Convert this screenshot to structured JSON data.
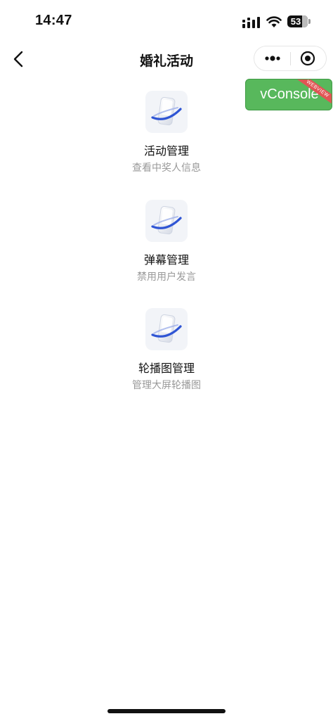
{
  "status_bar": {
    "time": "14:47",
    "battery_level": "53",
    "signal_icon": "signal-bars-icon",
    "wifi_icon": "wifi-icon"
  },
  "nav": {
    "title": "婚礼活动",
    "back_icon": "chevron-left-icon",
    "more_icon": "more-dots-icon",
    "close_icon": "miniprogram-close-icon"
  },
  "vconsole": {
    "label": "vConsole",
    "ribbon": "WEBVIEW",
    "color": "#58b85c"
  },
  "menu": [
    {
      "title": "活动管理",
      "subtitle": "查看中奖人信息",
      "icon": "phone-ring-icon"
    },
    {
      "title": "弹幕管理",
      "subtitle": "禁用用户发言",
      "icon": "phone-ring-icon"
    },
    {
      "title": "轮播图管理",
      "subtitle": "管理大屏轮播图",
      "icon": "phone-ring-icon"
    }
  ],
  "colors": {
    "accent_blue": "#2f55d4",
    "subtitle_gray": "#999999"
  }
}
